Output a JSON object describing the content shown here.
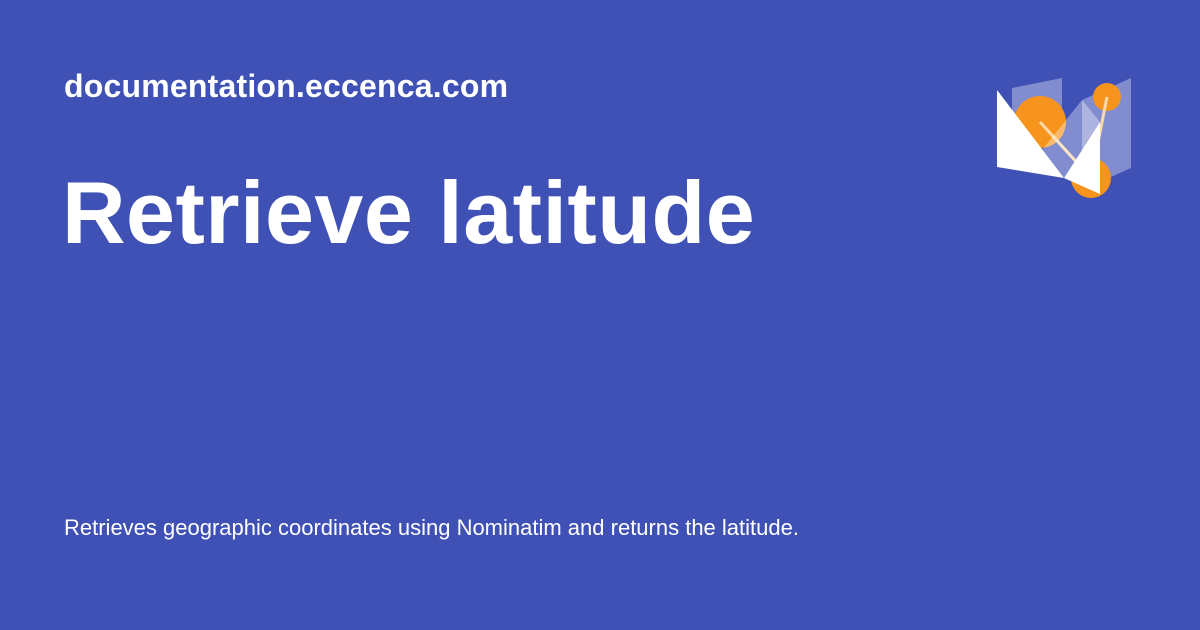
{
  "card": {
    "site": "documentation.eccenca.com",
    "title": "Retrieve latitude",
    "description": "Retrieves geographic coordinates using Nominatim and returns the latitude."
  },
  "logo": {
    "icon": "eccenca-logo-icon"
  },
  "colors": {
    "background": "#3f51b5",
    "text": "#ffffff",
    "accent": "#f7941d"
  }
}
